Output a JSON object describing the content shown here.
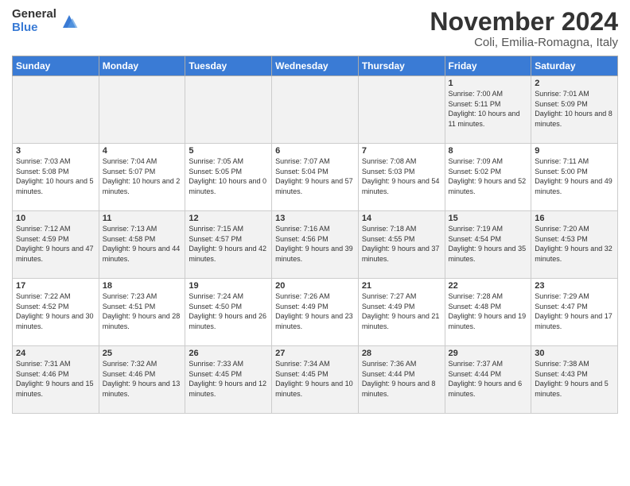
{
  "logo": {
    "general": "General",
    "blue": "Blue"
  },
  "header": {
    "month": "November 2024",
    "location": "Coli, Emilia-Romagna, Italy"
  },
  "weekdays": [
    "Sunday",
    "Monday",
    "Tuesday",
    "Wednesday",
    "Thursday",
    "Friday",
    "Saturday"
  ],
  "weeks": [
    [
      {
        "day": "",
        "info": ""
      },
      {
        "day": "",
        "info": ""
      },
      {
        "day": "",
        "info": ""
      },
      {
        "day": "",
        "info": ""
      },
      {
        "day": "",
        "info": ""
      },
      {
        "day": "1",
        "info": "Sunrise: 7:00 AM\nSunset: 5:11 PM\nDaylight: 10 hours and 11 minutes."
      },
      {
        "day": "2",
        "info": "Sunrise: 7:01 AM\nSunset: 5:09 PM\nDaylight: 10 hours and 8 minutes."
      }
    ],
    [
      {
        "day": "3",
        "info": "Sunrise: 7:03 AM\nSunset: 5:08 PM\nDaylight: 10 hours and 5 minutes."
      },
      {
        "day": "4",
        "info": "Sunrise: 7:04 AM\nSunset: 5:07 PM\nDaylight: 10 hours and 2 minutes."
      },
      {
        "day": "5",
        "info": "Sunrise: 7:05 AM\nSunset: 5:05 PM\nDaylight: 10 hours and 0 minutes."
      },
      {
        "day": "6",
        "info": "Sunrise: 7:07 AM\nSunset: 5:04 PM\nDaylight: 9 hours and 57 minutes."
      },
      {
        "day": "7",
        "info": "Sunrise: 7:08 AM\nSunset: 5:03 PM\nDaylight: 9 hours and 54 minutes."
      },
      {
        "day": "8",
        "info": "Sunrise: 7:09 AM\nSunset: 5:02 PM\nDaylight: 9 hours and 52 minutes."
      },
      {
        "day": "9",
        "info": "Sunrise: 7:11 AM\nSunset: 5:00 PM\nDaylight: 9 hours and 49 minutes."
      }
    ],
    [
      {
        "day": "10",
        "info": "Sunrise: 7:12 AM\nSunset: 4:59 PM\nDaylight: 9 hours and 47 minutes."
      },
      {
        "day": "11",
        "info": "Sunrise: 7:13 AM\nSunset: 4:58 PM\nDaylight: 9 hours and 44 minutes."
      },
      {
        "day": "12",
        "info": "Sunrise: 7:15 AM\nSunset: 4:57 PM\nDaylight: 9 hours and 42 minutes."
      },
      {
        "day": "13",
        "info": "Sunrise: 7:16 AM\nSunset: 4:56 PM\nDaylight: 9 hours and 39 minutes."
      },
      {
        "day": "14",
        "info": "Sunrise: 7:18 AM\nSunset: 4:55 PM\nDaylight: 9 hours and 37 minutes."
      },
      {
        "day": "15",
        "info": "Sunrise: 7:19 AM\nSunset: 4:54 PM\nDaylight: 9 hours and 35 minutes."
      },
      {
        "day": "16",
        "info": "Sunrise: 7:20 AM\nSunset: 4:53 PM\nDaylight: 9 hours and 32 minutes."
      }
    ],
    [
      {
        "day": "17",
        "info": "Sunrise: 7:22 AM\nSunset: 4:52 PM\nDaylight: 9 hours and 30 minutes."
      },
      {
        "day": "18",
        "info": "Sunrise: 7:23 AM\nSunset: 4:51 PM\nDaylight: 9 hours and 28 minutes."
      },
      {
        "day": "19",
        "info": "Sunrise: 7:24 AM\nSunset: 4:50 PM\nDaylight: 9 hours and 26 minutes."
      },
      {
        "day": "20",
        "info": "Sunrise: 7:26 AM\nSunset: 4:49 PM\nDaylight: 9 hours and 23 minutes."
      },
      {
        "day": "21",
        "info": "Sunrise: 7:27 AM\nSunset: 4:49 PM\nDaylight: 9 hours and 21 minutes."
      },
      {
        "day": "22",
        "info": "Sunrise: 7:28 AM\nSunset: 4:48 PM\nDaylight: 9 hours and 19 minutes."
      },
      {
        "day": "23",
        "info": "Sunrise: 7:29 AM\nSunset: 4:47 PM\nDaylight: 9 hours and 17 minutes."
      }
    ],
    [
      {
        "day": "24",
        "info": "Sunrise: 7:31 AM\nSunset: 4:46 PM\nDaylight: 9 hours and 15 minutes."
      },
      {
        "day": "25",
        "info": "Sunrise: 7:32 AM\nSunset: 4:46 PM\nDaylight: 9 hours and 13 minutes."
      },
      {
        "day": "26",
        "info": "Sunrise: 7:33 AM\nSunset: 4:45 PM\nDaylight: 9 hours and 12 minutes."
      },
      {
        "day": "27",
        "info": "Sunrise: 7:34 AM\nSunset: 4:45 PM\nDaylight: 9 hours and 10 minutes."
      },
      {
        "day": "28",
        "info": "Sunrise: 7:36 AM\nSunset: 4:44 PM\nDaylight: 9 hours and 8 minutes."
      },
      {
        "day": "29",
        "info": "Sunrise: 7:37 AM\nSunset: 4:44 PM\nDaylight: 9 hours and 6 minutes."
      },
      {
        "day": "30",
        "info": "Sunrise: 7:38 AM\nSunset: 4:43 PM\nDaylight: 9 hours and 5 minutes."
      }
    ]
  ]
}
